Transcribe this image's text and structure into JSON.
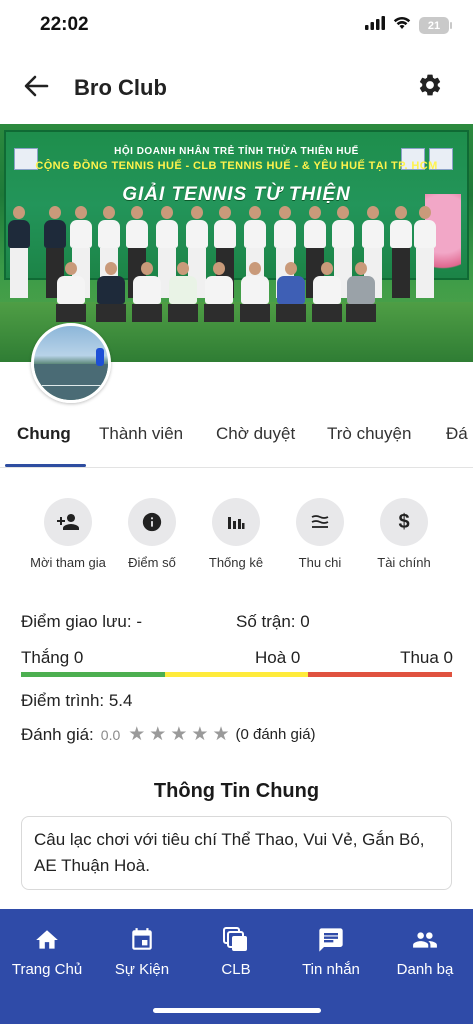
{
  "status_bar": {
    "time": "22:02",
    "battery": "21",
    "icons": [
      "signal-icon",
      "wifi-icon",
      "battery-icon"
    ]
  },
  "header": {
    "title": "Bro Club",
    "back_icon": "back-arrow-icon",
    "settings_icon": "gear-icon"
  },
  "cover": {
    "banner_line1": "HỘI DOANH NHÂN TRẺ TỈNH THỪA THIÊN HUẾ",
    "banner_line2": "CỘNG ĐỒNG TENNIS HUẾ - CLB TENNIS HUẾ - & YÊU HUẾ TẠI TP. HCM",
    "banner_line3": "GIẢI TENNIS TỪ THIỆN"
  },
  "tabs": [
    "Chung",
    "Thành viên",
    "Chờ duyệt",
    "Trò chuyện",
    "Đá"
  ],
  "actions": [
    {
      "label": "Mời tham gia",
      "icon": "add-person-icon"
    },
    {
      "label": "Điểm số",
      "icon": "info-icon"
    },
    {
      "label": "Thống kê",
      "icon": "bar-chart-icon"
    },
    {
      "label": "Thu chi",
      "icon": "wave-icon"
    },
    {
      "label": "Tài chính",
      "icon": "dollar-icon"
    }
  ],
  "stats": {
    "diem_giao_luu": "Điểm giao lưu: -",
    "so_tran": "Số trận: 0",
    "thang": "Thắng 0",
    "hoa": "Hoà 0",
    "thua": "Thua 0",
    "diem_trinh": "Điểm trình: 5.4",
    "danh_gia_label": "Đánh giá:",
    "rating_value": "0.0",
    "rating_count": "(0 đánh giá)",
    "stars_filled": 0,
    "stars_total": 5,
    "bar_colors": {
      "win": "#4caf50",
      "draw": "#ffeb3b",
      "loss": "#e0523f"
    }
  },
  "info": {
    "title": "Thông Tin Chung",
    "description": "Câu lạc chơi với tiêu chí Thể Thao, Vui Vẻ, Gắn Bó, AE Thuận Hoà."
  },
  "bottom_nav": [
    {
      "label": "Trang Chủ",
      "icon": "home-icon"
    },
    {
      "label": "Sự Kiện",
      "icon": "calendar-icon"
    },
    {
      "label": "CLB",
      "icon": "club-icon"
    },
    {
      "label": "Tin nhắn",
      "icon": "chat-icon"
    },
    {
      "label": "Danh bạ",
      "icon": "contacts-icon"
    }
  ],
  "colors": {
    "accent": "#2f4ba8",
    "nav_background": "#2f4ba8"
  }
}
